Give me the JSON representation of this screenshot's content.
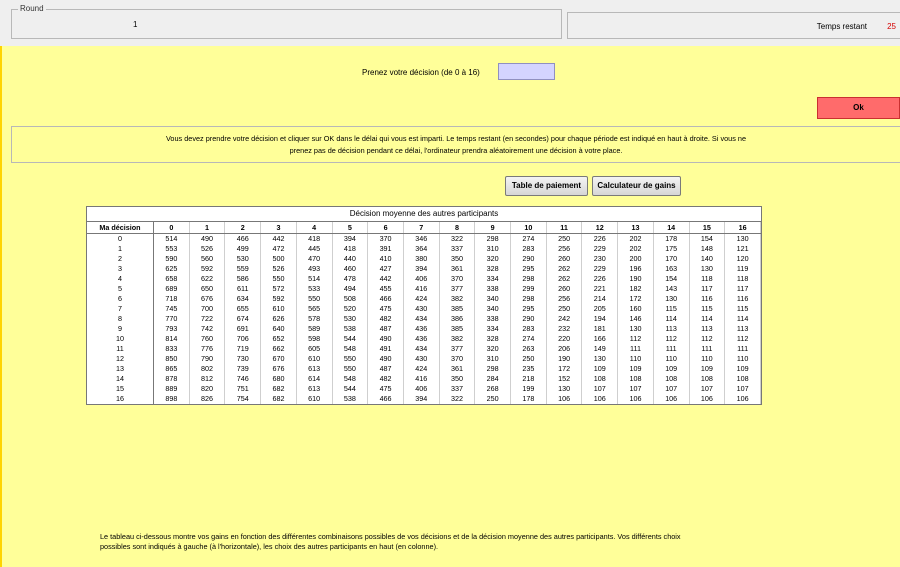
{
  "round": {
    "legend": "Round",
    "value": "1"
  },
  "timer": {
    "label": "Temps restant",
    "value": "25"
  },
  "decision": {
    "label": "Prenez votre décision (de 0 à 16)",
    "value": ""
  },
  "ok_label": "Ok",
  "instructions": {
    "line1": "Vous devez prendre votre décision et cliquer sur OK dans le délai qui vous est imparti. Le temps restant (en secondes) pour chaque période est indiqué en haut à droite. Si vous ne",
    "line2": "prenez pas de décision pendant ce délai, l'ordinateur prendra aléatoirement une décision à votre place."
  },
  "buttons": {
    "payment": "Table de paiement",
    "calculator": "Calculateur de gains"
  },
  "table": {
    "caption": "Décision moyenne des autres participants",
    "row_header": "Ma décision",
    "columns": [
      "0",
      "1",
      "2",
      "3",
      "4",
      "5",
      "6",
      "7",
      "8",
      "9",
      "10",
      "11",
      "12",
      "13",
      "14",
      "15",
      "16"
    ],
    "rows": [
      [
        "0",
        514,
        490,
        466,
        442,
        418,
        394,
        370,
        346,
        322,
        298,
        274,
        250,
        226,
        202,
        178,
        154,
        130
      ],
      [
        "1",
        553,
        526,
        499,
        472,
        445,
        418,
        391,
        364,
        337,
        310,
        283,
        256,
        229,
        202,
        175,
        148,
        121
      ],
      [
        "2",
        590,
        560,
        530,
        500,
        470,
        440,
        410,
        380,
        350,
        320,
        290,
        260,
        230,
        200,
        170,
        140,
        120
      ],
      [
        "3",
        625,
        592,
        559,
        526,
        493,
        460,
        427,
        394,
        361,
        328,
        295,
        262,
        229,
        196,
        163,
        130,
        119
      ],
      [
        "4",
        658,
        622,
        586,
        550,
        514,
        478,
        442,
        406,
        370,
        334,
        298,
        262,
        226,
        190,
        154,
        118,
        118
      ],
      [
        "5",
        689,
        650,
        611,
        572,
        533,
        494,
        455,
        416,
        377,
        338,
        299,
        260,
        221,
        182,
        143,
        117,
        117
      ],
      [
        "6",
        718,
        676,
        634,
        592,
        550,
        508,
        466,
        424,
        382,
        340,
        298,
        256,
        214,
        172,
        130,
        116,
        116
      ],
      [
        "7",
        745,
        700,
        655,
        610,
        565,
        520,
        475,
        430,
        385,
        340,
        295,
        250,
        205,
        160,
        115,
        115,
        115
      ],
      [
        "8",
        770,
        722,
        674,
        626,
        578,
        530,
        482,
        434,
        386,
        338,
        290,
        242,
        194,
        146,
        114,
        114,
        114
      ],
      [
        "9",
        793,
        742,
        691,
        640,
        589,
        538,
        487,
        436,
        385,
        334,
        283,
        232,
        181,
        130,
        113,
        113,
        113
      ],
      [
        "10",
        814,
        760,
        706,
        652,
        598,
        544,
        490,
        436,
        382,
        328,
        274,
        220,
        166,
        112,
        112,
        112,
        112
      ],
      [
        "11",
        833,
        776,
        719,
        662,
        605,
        548,
        491,
        434,
        377,
        320,
        263,
        206,
        149,
        111,
        111,
        111,
        111
      ],
      [
        "12",
        850,
        790,
        730,
        670,
        610,
        550,
        490,
        430,
        370,
        310,
        250,
        190,
        130,
        110,
        110,
        110,
        110
      ],
      [
        "13",
        865,
        802,
        739,
        676,
        613,
        550,
        487,
        424,
        361,
        298,
        235,
        172,
        109,
        109,
        109,
        109,
        109
      ],
      [
        "14",
        878,
        812,
        746,
        680,
        614,
        548,
        482,
        416,
        350,
        284,
        218,
        152,
        108,
        108,
        108,
        108,
        108
      ],
      [
        "15",
        889,
        820,
        751,
        682,
        613,
        544,
        475,
        406,
        337,
        268,
        199,
        130,
        107,
        107,
        107,
        107,
        107
      ],
      [
        "16",
        898,
        826,
        754,
        682,
        610,
        538,
        466,
        394,
        322,
        250,
        178,
        106,
        106,
        106,
        106,
        106,
        106
      ]
    ]
  },
  "footer": {
    "line1": "Le tableau ci-dessous montre vos gains en fonction des différentes combinaisons possibles de vos décisions et de la décision moyenne des autres participants. Vos différents choix",
    "line2": "possibles sont indiqués à gauche (à l'horizontale), les choix des autres participants en haut (en colonne)."
  }
}
